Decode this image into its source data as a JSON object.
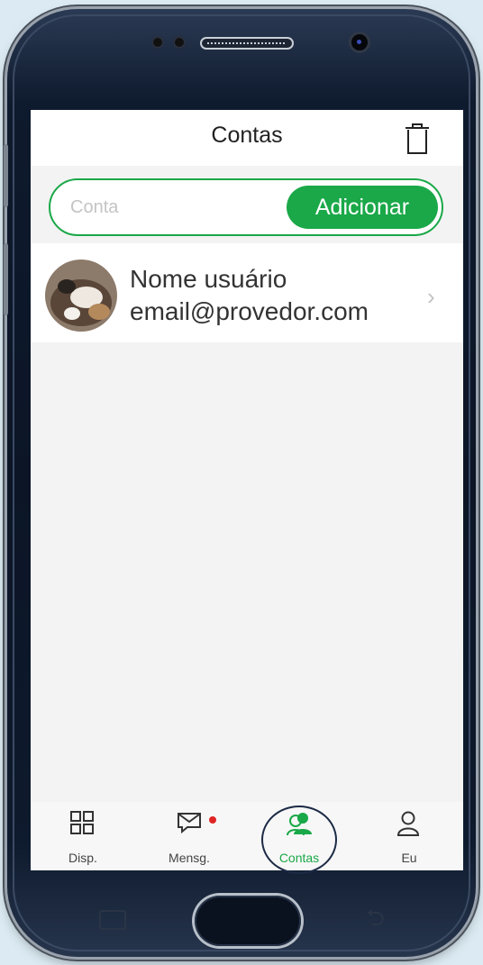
{
  "header": {
    "title": "Contas"
  },
  "search": {
    "placeholder": "Conta",
    "value": "",
    "add_label": "Adicionar"
  },
  "account": {
    "name": "Nome usuário",
    "email": "email@provedor.com"
  },
  "tabs": [
    {
      "label": "Disp.",
      "icon": "grid-icon"
    },
    {
      "label": "Mensg.",
      "icon": "message-icon"
    },
    {
      "label": "Contas",
      "icon": "accounts-icon"
    },
    {
      "label": "Eu",
      "icon": "person-icon"
    }
  ],
  "colors": {
    "accent": "#1aa848",
    "badge": "#e02424",
    "background": "#f3f3f3"
  }
}
